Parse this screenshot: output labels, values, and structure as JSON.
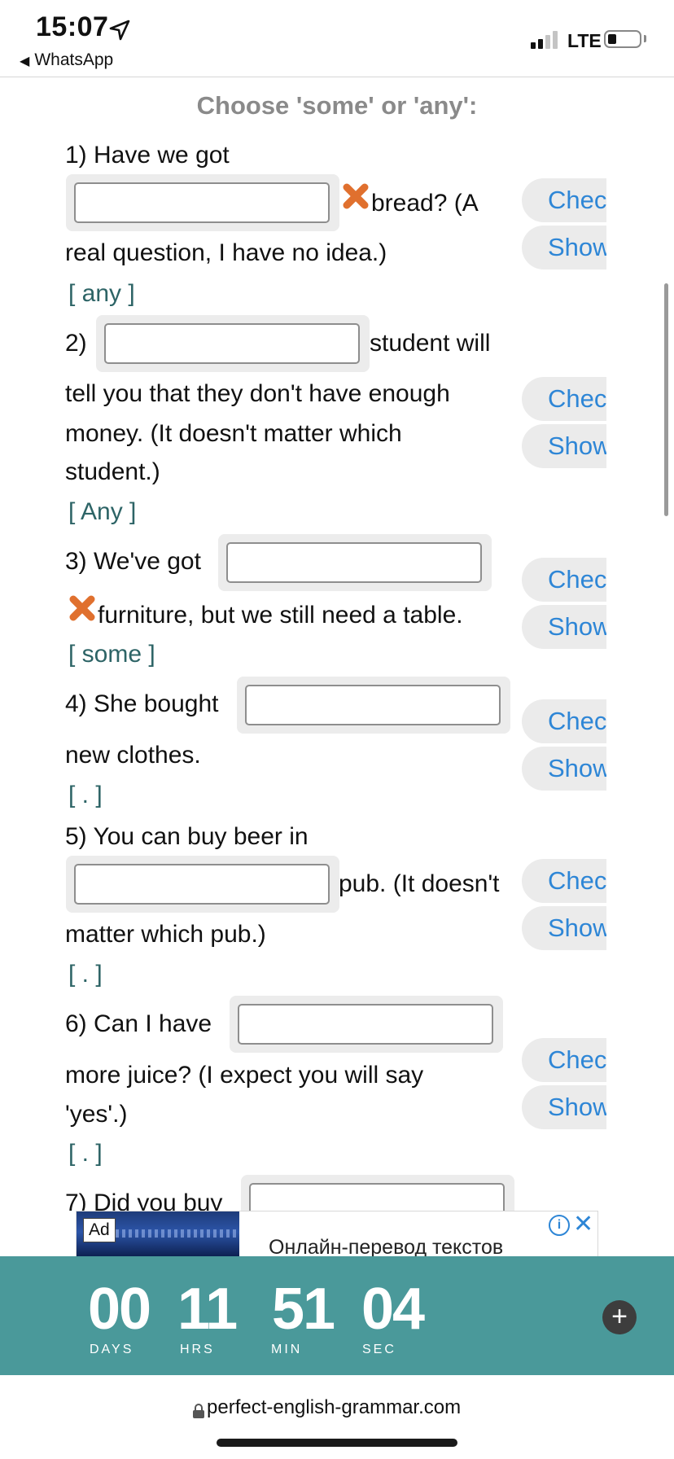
{
  "status_bar": {
    "time": "15:07",
    "back_app": "WhatsApp",
    "network": "LTE"
  },
  "exercise": {
    "heading": "Choose 'some' or 'any':",
    "check_label": "Check",
    "show_label": "Show",
    "questions": [
      {
        "line1": "1) Have we got",
        "after_input": "bread? (A",
        "line3": "real question, I have no idea.)",
        "answer": "[ any ]"
      },
      {
        "prefix": "2)",
        "after_input": "student will",
        "line2": "tell you that they don't have enough",
        "line3": "money. (It doesn't matter which",
        "line4": "student.)",
        "answer": "[ Any ]"
      },
      {
        "prefix": "3) We've got",
        "line2": "furniture, but we still need a table.",
        "answer": "[ some ]"
      },
      {
        "prefix": "4) She bought",
        "line2": "new clothes.",
        "answer": "[ . ]"
      },
      {
        "line1": "5) You can buy beer in",
        "after_input": "pub. (It doesn't",
        "line3": "matter which pub.)",
        "answer": "[ . ]"
      },
      {
        "prefix": "6) Can I have",
        "line2": "more juice? (I expect you will say",
        "line3": "'yes'.)",
        "answer": "[ . ]"
      },
      {
        "prefix": "7) Did you buy"
      }
    ]
  },
  "ad": {
    "badge": "Ad",
    "text": "Онлайн-перевод текстов",
    "info_icon": "info-icon",
    "close_icon": "close-icon"
  },
  "countdown": {
    "days": "00",
    "hours": "11",
    "minutes": "51",
    "seconds": "04",
    "days_label": "DAYS",
    "hours_label": "HRS",
    "minutes_label": "MIN",
    "seconds_label": "SEC"
  },
  "browser": {
    "url": "perfect-english-grammar.com"
  },
  "colors": {
    "accent_blue": "#2e86d6",
    "answer_teal": "#2d6466",
    "countdown_bg": "#4a999a",
    "heading_gray": "#8a8a8a",
    "wrong_mark": "#e0702e"
  }
}
